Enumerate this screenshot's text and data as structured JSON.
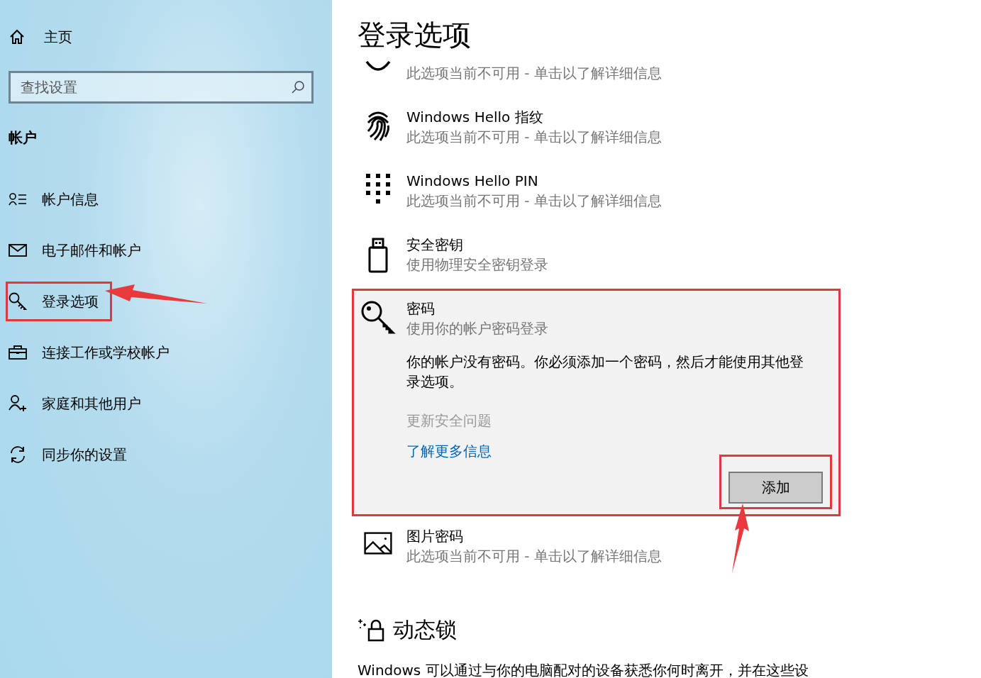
{
  "sidebar": {
    "home": {
      "label": "主页"
    },
    "search": {
      "placeholder": "查找设置"
    },
    "section_title": "帐户",
    "items": [
      {
        "kind": "person-list",
        "label": "帐户信息",
        "red_box": false
      },
      {
        "kind": "mail",
        "label": "电子邮件和帐户",
        "red_box": false
      },
      {
        "kind": "key",
        "label": "登录选项",
        "red_box": true,
        "arrow": true
      },
      {
        "kind": "briefcase",
        "label": "连接工作或学校帐户",
        "red_box": false
      },
      {
        "kind": "person-add",
        "label": "家庭和其他用户",
        "red_box": false
      },
      {
        "kind": "sync",
        "label": "同步你的设置",
        "red_box": false
      }
    ]
  },
  "main": {
    "title": "登录选项",
    "options": [
      {
        "kind": "face",
        "subtitle": "此选项当前不可用 - 单击以了解详细信息"
      },
      {
        "kind": "fingerprint",
        "title": "Windows Hello 指纹",
        "subtitle": "此选项当前不可用 - 单击以了解详细信息"
      },
      {
        "kind": "pin",
        "title": "Windows Hello PIN",
        "subtitle": "此选项当前不可用 - 单击以了解详细信息"
      },
      {
        "kind": "usb-key",
        "title": "安全密钥",
        "subtitle": "使用物理安全密钥登录"
      },
      {
        "kind": "password",
        "title": "密码",
        "subtitle": "使用你的帐户密码登录",
        "expanded": true,
        "red_box": true,
        "message": "你的帐户没有密码。你必须添加一个密码，然后才能使用其他登录选项。",
        "links": [
          {
            "label": "更新安全问题",
            "disabled": true
          },
          {
            "label": "了解更多信息",
            "disabled": false
          }
        ],
        "button": {
          "label": "添加",
          "red_box": true,
          "arrow": true
        }
      },
      {
        "kind": "picture",
        "title": "图片密码",
        "subtitle": "此选项当前不可用 - 单击以了解详细信息"
      }
    ],
    "dynamic_lock": {
      "heading": "动态锁",
      "text": "Windows 可以通过与你的电脑配对的设备获悉你何时离开，并在这些设"
    }
  }
}
